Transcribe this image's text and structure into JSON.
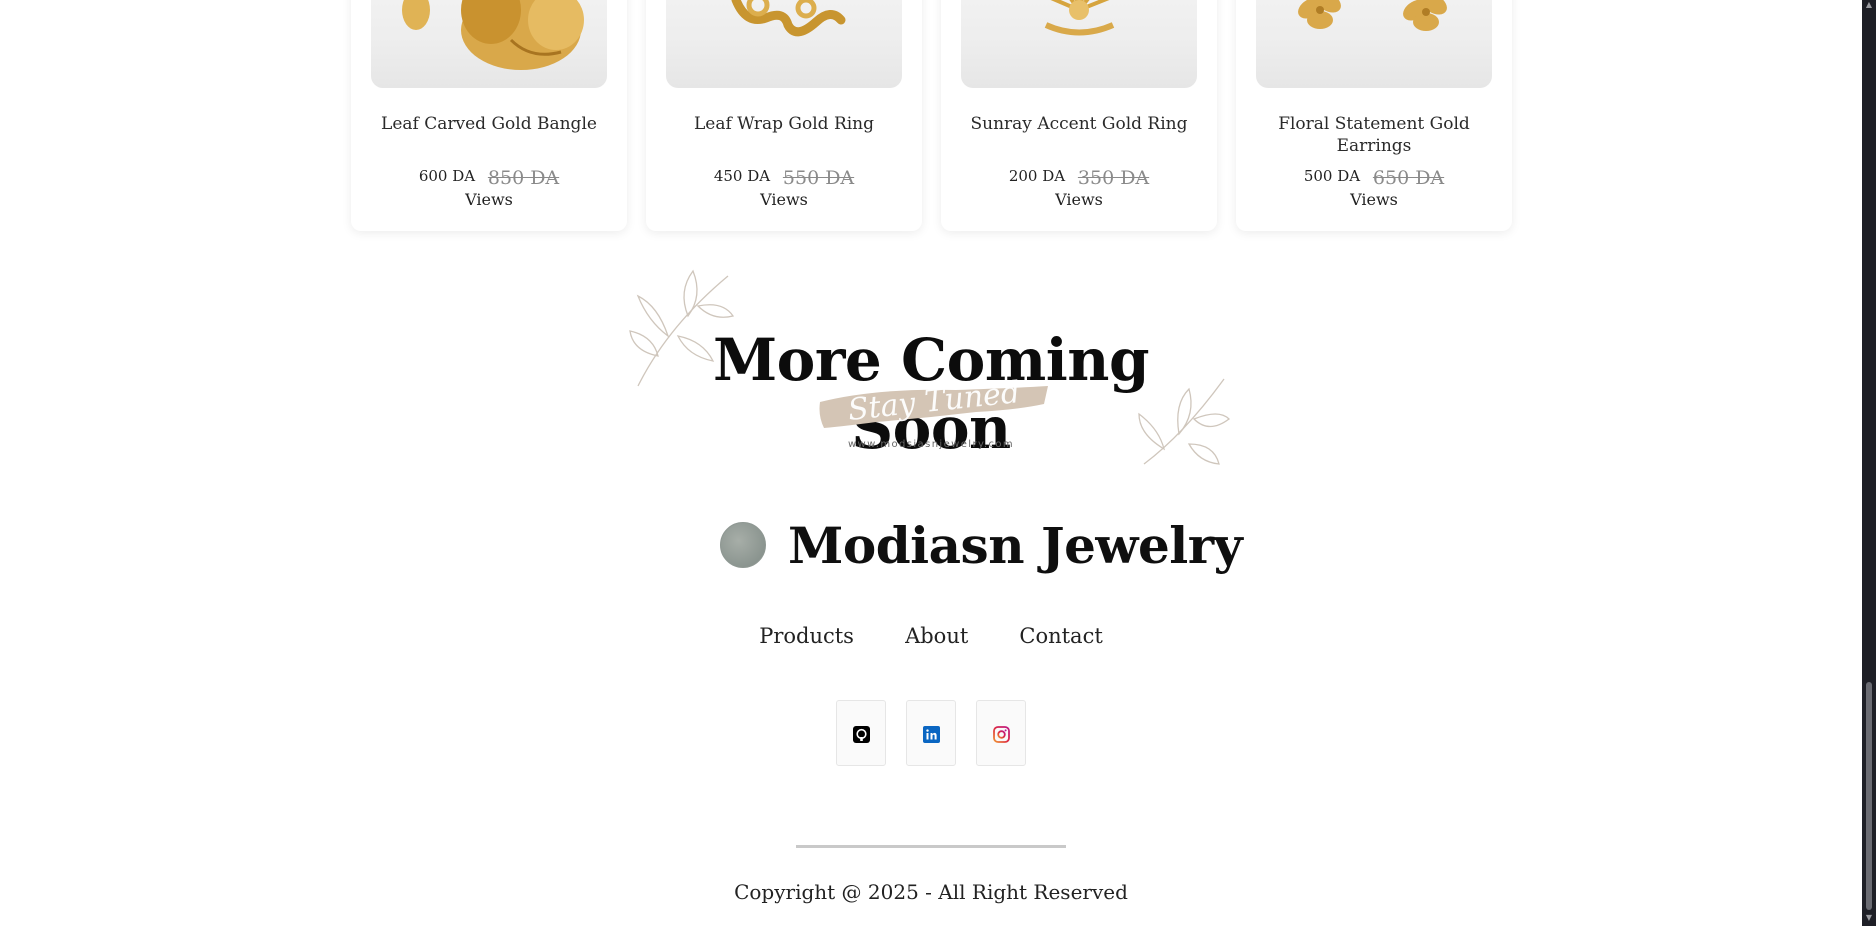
{
  "products": [
    {
      "name": "Leaf Carved Gold Bangle",
      "price": "600 DA",
      "old_price": "850 DA",
      "views": "Views"
    },
    {
      "name": "Leaf Wrap Gold Ring",
      "price": "450 DA",
      "old_price": "550 DA",
      "views": "Views"
    },
    {
      "name": "Sunray Accent Gold Ring",
      "price": "200 DA",
      "old_price": "350 DA",
      "views": "Views"
    },
    {
      "name": "Floral Statement Gold Earrings",
      "price": "500 DA",
      "old_price": "650 DA",
      "views": "Views"
    }
  ],
  "banner": {
    "title": "More Coming Soon",
    "subtitle": "Stay Tuned",
    "url": "www.modsiasnjewelry.com"
  },
  "brand": {
    "name": "Modiasn Jewelry"
  },
  "nav": {
    "products": "Products",
    "about": "About",
    "contact": "Contact"
  },
  "social": {
    "icons": [
      "github-icon",
      "linkedin-icon",
      "instagram-icon"
    ],
    "linkedin_color": "#0a66c2",
    "instagram_color": "#c13584"
  },
  "footer": {
    "copyright": "Copyright @ 2025 - All Right Reserved"
  },
  "colors": {
    "accent_brush": "#d4c5b5",
    "gold": "#d4a53a",
    "scrollbar": "#1e1f26"
  }
}
